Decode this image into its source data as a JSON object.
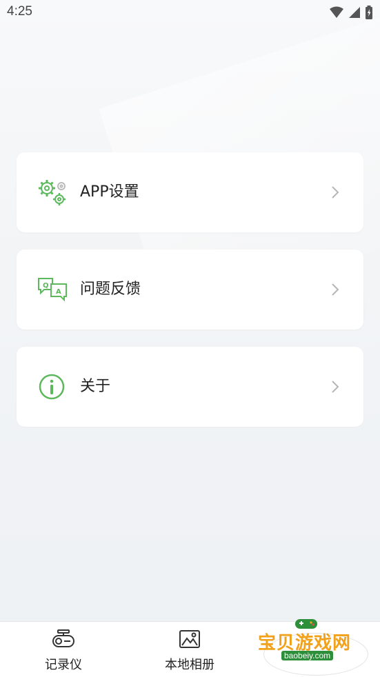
{
  "status_bar": {
    "time": "4:25"
  },
  "menu": {
    "items": [
      {
        "label": "APP设置",
        "icon": "settings-gears-icon"
      },
      {
        "label": "问题反馈",
        "icon": "qa-feedback-icon"
      },
      {
        "label": "关于",
        "icon": "info-icon"
      }
    ]
  },
  "tabbar": {
    "tabs": [
      {
        "label": "记录仪",
        "icon": "dashcam-icon"
      },
      {
        "label": "本地相册",
        "icon": "album-icon"
      }
    ]
  },
  "watermark": {
    "text": "宝贝游戏网",
    "url": "baobeiy.com"
  },
  "colors": {
    "accent": "#5cb85c",
    "background": "#f2f4f6",
    "card": "#ffffff"
  }
}
